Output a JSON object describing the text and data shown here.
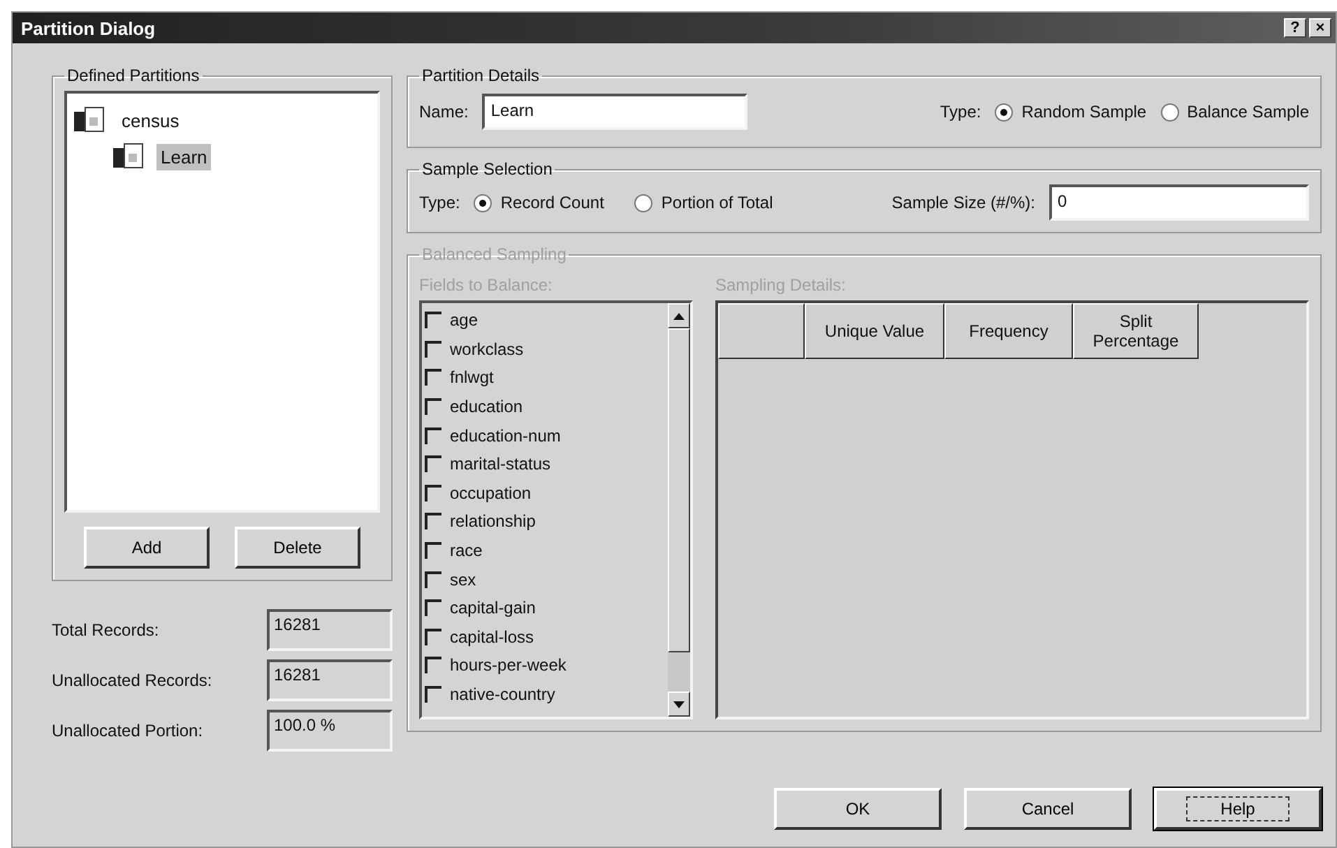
{
  "window": {
    "title": "Partition Dialog",
    "controls": [
      "?",
      "×"
    ]
  },
  "defined_partitions": {
    "title": "Defined Partitions",
    "tree": [
      {
        "label": "census",
        "selected": false,
        "children": [
          {
            "label": "Learn",
            "selected": true
          }
        ]
      }
    ],
    "buttons": [
      "Add",
      "Delete"
    ]
  },
  "stats": [
    {
      "label": "Total Records:",
      "value": "16281"
    },
    {
      "label": "Unallocated Records:",
      "value": "16281"
    },
    {
      "label": "Unallocated Portion:",
      "value": "100.0 %"
    }
  ],
  "partition_details": {
    "title": "Partition Details",
    "name_label": "Name:",
    "name_value": "Learn",
    "type_label": "Type:",
    "types": [
      {
        "label": "Random Sample",
        "selected": true
      },
      {
        "label": "Balance Sample",
        "selected": false
      }
    ]
  },
  "sample_selection": {
    "title": "Sample Selection",
    "type_label": "Type:",
    "types": [
      {
        "label": "Record Count",
        "selected": true
      },
      {
        "label": "Portion of Total",
        "selected": false
      }
    ],
    "size_label": "Sample Size (#/%):",
    "size_value": "0"
  },
  "balanced_sampling": {
    "title": "Balanced Sampling",
    "disabled": true,
    "fields_label": "Fields to Balance:",
    "fields": [
      {
        "label": "age",
        "checked": false
      },
      {
        "label": "workclass",
        "checked": false
      },
      {
        "label": "fnlwgt",
        "checked": false
      },
      {
        "label": "education",
        "checked": false
      },
      {
        "label": "education-num",
        "checked": false
      },
      {
        "label": "marital-status",
        "checked": false
      },
      {
        "label": "occupation",
        "checked": false
      },
      {
        "label": "relationship",
        "checked": false
      },
      {
        "label": "race",
        "checked": false
      },
      {
        "label": "sex",
        "checked": false
      },
      {
        "label": "capital-gain",
        "checked": false
      },
      {
        "label": "capital-loss",
        "checked": false
      },
      {
        "label": "hours-per-week",
        "checked": false
      },
      {
        "label": "native-country",
        "checked": false
      }
    ],
    "details_label": "Sampling Details:",
    "columns": [
      "",
      "Unique Value",
      "Frequency",
      "Split Percentage"
    ]
  },
  "buttons": [
    {
      "label": "OK",
      "default": false
    },
    {
      "label": "Cancel",
      "default": false
    },
    {
      "label": "Help",
      "default": true
    }
  ]
}
